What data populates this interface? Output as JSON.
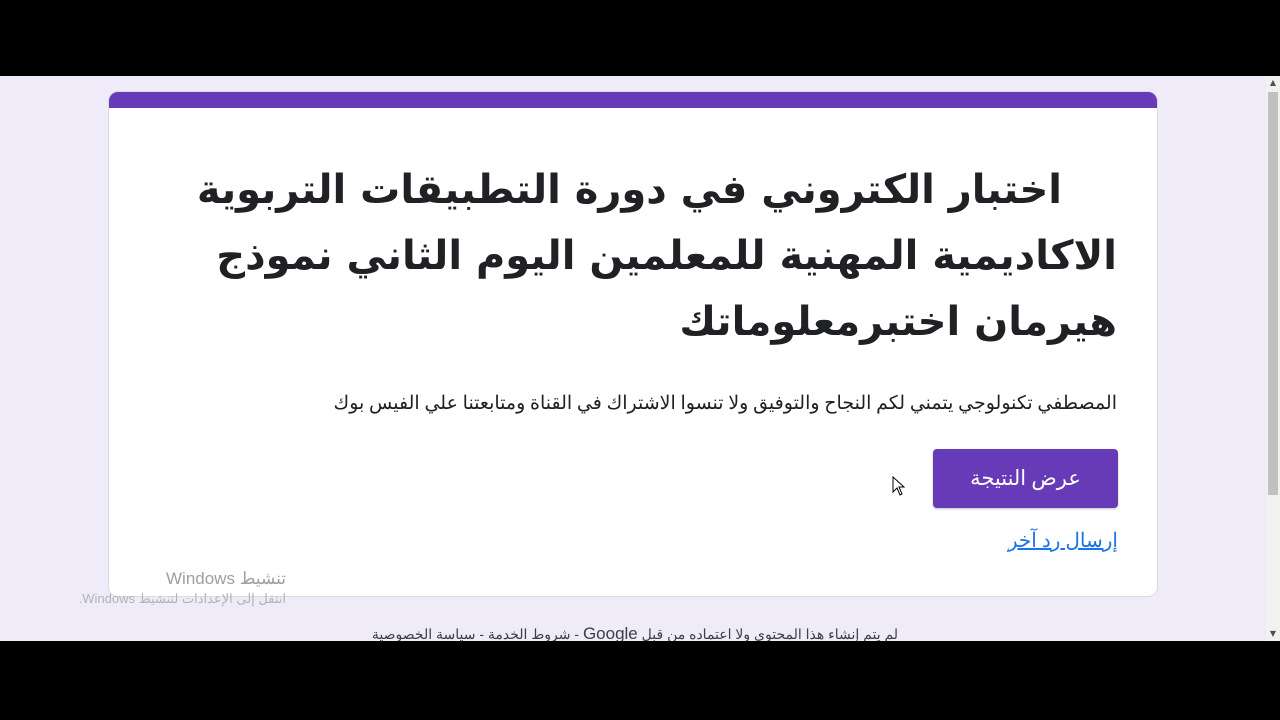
{
  "form": {
    "title": "اختبار الكتروني في دورة التطبيقات التربوية الاكاديمية المهنية للمعلمين اليوم الثاني نموذج هيرمان اختبرمعلوماتك",
    "description": "المصطفي تكنولوجي يتمني لكم النجاح والتوفيق ولا تنسوا الاشتراك في القناة ومتابعتنا علي الفيس بوك",
    "view_result_label": "عرض النتيجة",
    "submit_another_label": "إرسال رد آخر",
    "accent_color": "#673ab7",
    "link_color": "#1a73e8"
  },
  "watermark": {
    "title": "تنشيط Windows",
    "subtitle": "انتقل إلى الإعدادات لتنشيط Windows."
  },
  "footer": {
    "prefix": "لم يتم إنشاء هذا المحتوى ولا اعتماده من قبل",
    "brand": "Google",
    "suffix": "- شروط الخدمة - سياسة الخصوصية"
  },
  "icons": {
    "scroll_up": "scroll-up-arrow-icon",
    "scroll_down": "scroll-down-arrow-icon",
    "cursor": "mouse-pointer-icon"
  }
}
